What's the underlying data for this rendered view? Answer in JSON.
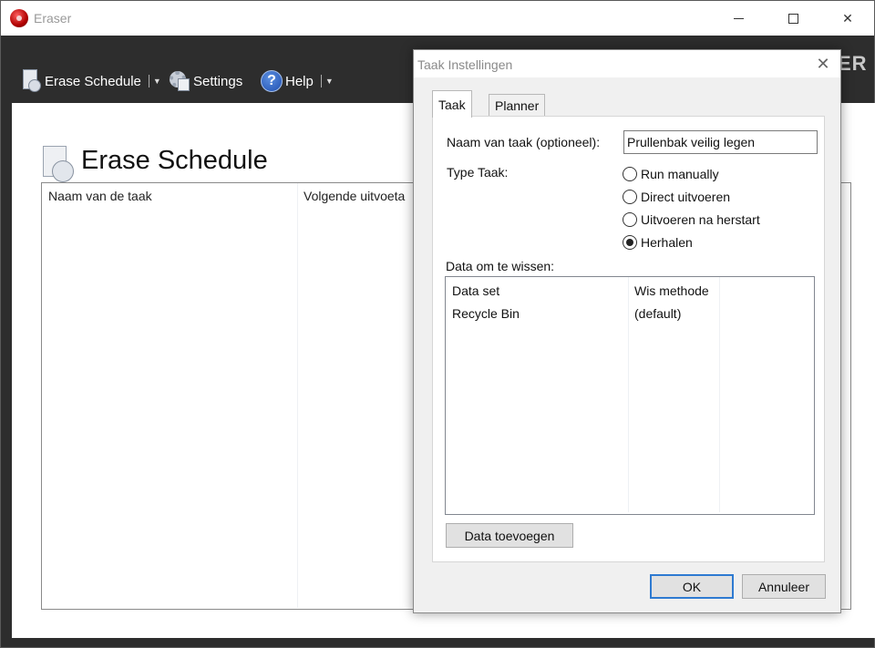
{
  "window": {
    "title": "Eraser",
    "brand_tail": "ER"
  },
  "toolbar": {
    "schedule_label": "Erase Schedule",
    "settings_label": "Settings",
    "help_label": "Help"
  },
  "main": {
    "title": "Erase Schedule",
    "columns": [
      "Naam van de taak",
      "Volgende uitvoeta"
    ]
  },
  "dialog": {
    "title": "Taak Instellingen",
    "tabs": [
      {
        "label": "Taak",
        "active": true
      },
      {
        "label": "Planner",
        "active": false
      }
    ],
    "name_label": "Naam van taak (optioneel):",
    "name_value": "Prullenbak veilig legen",
    "type_label": "Type Taak:",
    "type_options": [
      {
        "label": "Run manually",
        "checked": false
      },
      {
        "label": "Direct uitvoeren",
        "checked": false
      },
      {
        "label": "Uitvoeren na herstart",
        "checked": false
      },
      {
        "label": "Herhalen",
        "checked": true
      }
    ],
    "data_label": "Data om te wissen:",
    "data_columns": [
      "Data set",
      "Wis methode"
    ],
    "data_rows": [
      {
        "set": "Recycle Bin",
        "method": "(default)"
      }
    ],
    "add_button": "Data toevoegen",
    "ok_button": "OK",
    "cancel_button": "Annuleer"
  }
}
